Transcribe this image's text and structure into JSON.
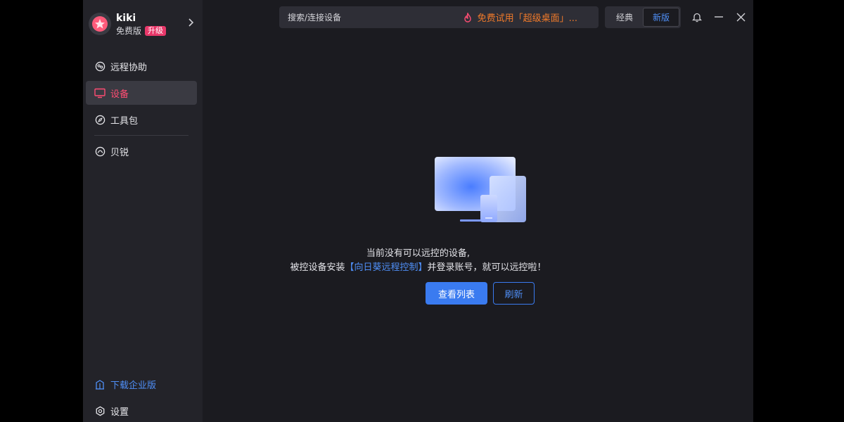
{
  "profile": {
    "name": "kiki",
    "plan": "免费版",
    "upgrade_label": "升级"
  },
  "sidebar": {
    "items": [
      {
        "label": "远程协助",
        "icon": "remote-assist-icon"
      },
      {
        "label": "设备",
        "icon": "monitor-icon",
        "active": true
      },
      {
        "label": "工具包",
        "icon": "compass-icon"
      },
      {
        "label": "贝锐",
        "icon": "oray-icon"
      }
    ],
    "download_enterprise": "下载企业版",
    "settings": "设置"
  },
  "topbar": {
    "search_placeholder": "搜索/连接设备",
    "promo": "免费试用「超级桌面」...",
    "switch_classic": "经典",
    "switch_new": "新版"
  },
  "empty_state": {
    "line1": "当前没有可以远控的设备,",
    "line2_prefix": "被控设备安装",
    "line2_link": "【向日葵远程控制】",
    "line2_suffix": "并登录账号，就可以远控啦！",
    "primary_button": "查看列表",
    "secondary_button": "刷新"
  },
  "colors": {
    "accent_pink": "#ff4d73",
    "accent_blue": "#3a7bf0",
    "promo_orange": "#f07a2a"
  }
}
